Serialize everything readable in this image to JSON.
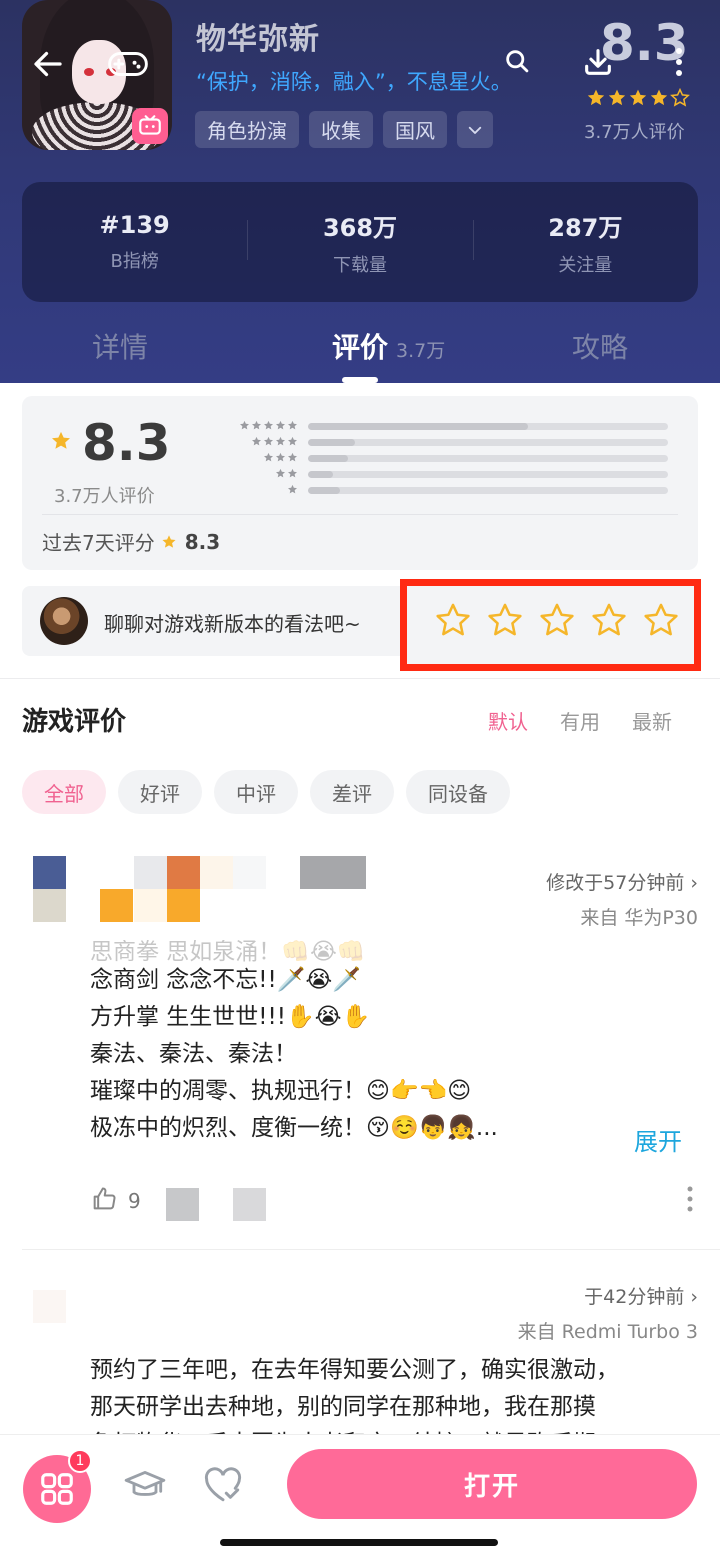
{
  "app": {
    "title": "物华弥新",
    "slogan": "“保护，消除，融入”，不息星火。",
    "tags": [
      "角色扮演",
      "收集",
      "国风"
    ],
    "score": "8.3",
    "score_stars": 4.5,
    "rating_count": "3.7万人评价"
  },
  "stats": [
    {
      "value": "#139",
      "label": "B指榜"
    },
    {
      "value": "368万",
      "label": "下载量"
    },
    {
      "value": "287万",
      "label": "关注量"
    }
  ],
  "tabs": [
    {
      "label": "详情",
      "sub": ""
    },
    {
      "label": "评价",
      "sub": "3.7万"
    },
    {
      "label": "攻略",
      "sub": ""
    }
  ],
  "rating": {
    "score": "8.3",
    "count": "3.7万人评价",
    "distribution": [
      0.61,
      0.13,
      0.11,
      0.07,
      0.09
    ],
    "week_label": "过去7天评分",
    "week_score": "8.3"
  },
  "prompt": {
    "text": "聊聊对游戏新版本的看法吧~"
  },
  "reviews_section": {
    "title": "游戏评价",
    "sorts": [
      "默认",
      "有用",
      "最新"
    ],
    "active_sort": "默认",
    "filters": [
      "全部",
      "好评",
      "中评",
      "差评",
      "同设备"
    ]
  },
  "reviews": [
    {
      "meta_time": "修改于57分钟前",
      "meta_device": "来自 华为P30",
      "lines": [
        "思商拳 思如泉涌！👊😭👊",
        "念商剑 念念不忘!!🗡️😭🗡️",
        "方升掌 生生世世!!!✋😭✋",
        "秦法、秦法、秦法！",
        "璀璨中的凋零、执规迅行！😊👉👈😊",
        "极冻中的炽烈、度衡一统！😚☺️👦👧..."
      ],
      "expand": "展开",
      "likes": "9"
    },
    {
      "meta_time": "于42分钟前",
      "meta_device": "来自 Redmi Turbo 3",
      "lines": [
        "预约了三年吧，在去年得知要公测了，确实很激动，",
        "那天研学出去种地，别的同学在那种地，我在那摸",
        "鱼打物华，后来因为太老和宫一结接，就是砍后期"
      ]
    }
  ],
  "bottom": {
    "badge": "1",
    "open_label": "打开"
  },
  "colors": {
    "header": "#303875",
    "accent": "#f06290",
    "open": "#ff6a98",
    "link": "#1da6dd",
    "star": "#f5b62a",
    "highlight": "#ff2a12"
  }
}
